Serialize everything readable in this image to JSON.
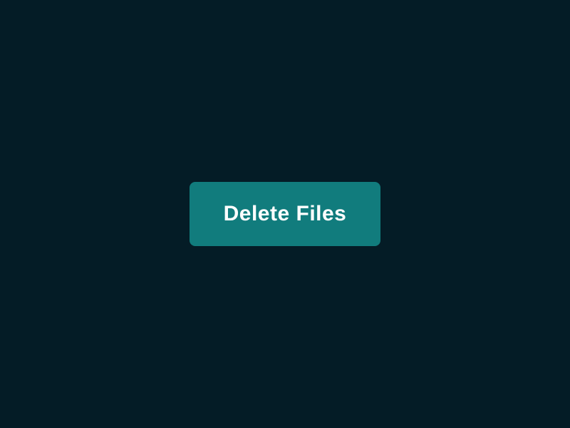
{
  "button": {
    "label": "Delete Files"
  },
  "colors": {
    "background": "#041C26",
    "button_bg": "#117C7D",
    "button_text": "#FFFFFF"
  }
}
